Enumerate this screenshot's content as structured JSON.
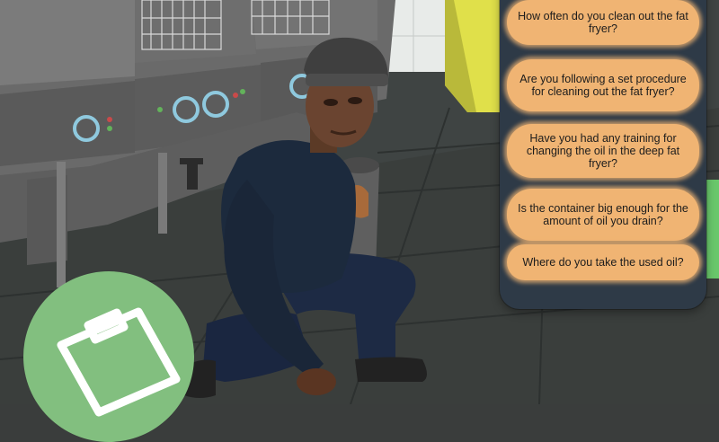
{
  "dialogue": {
    "options": [
      {
        "label": "How often do you clean out the fat fryer?"
      },
      {
        "label": "Are you following a set procedure for cleaning out the fat fryer?"
      },
      {
        "label": "Have you had any training for changing the oil in the deep fat fryer?"
      },
      {
        "label": "Is the container big enough for the amount of oil you drain?"
      },
      {
        "label": "Where do you take the used oil?"
      }
    ]
  },
  "hud": {
    "notes_icon": "clipboard-icon"
  },
  "colors": {
    "panel": "#2e3a47",
    "option": "#f0b473",
    "notes_button": "#82bf7f"
  }
}
